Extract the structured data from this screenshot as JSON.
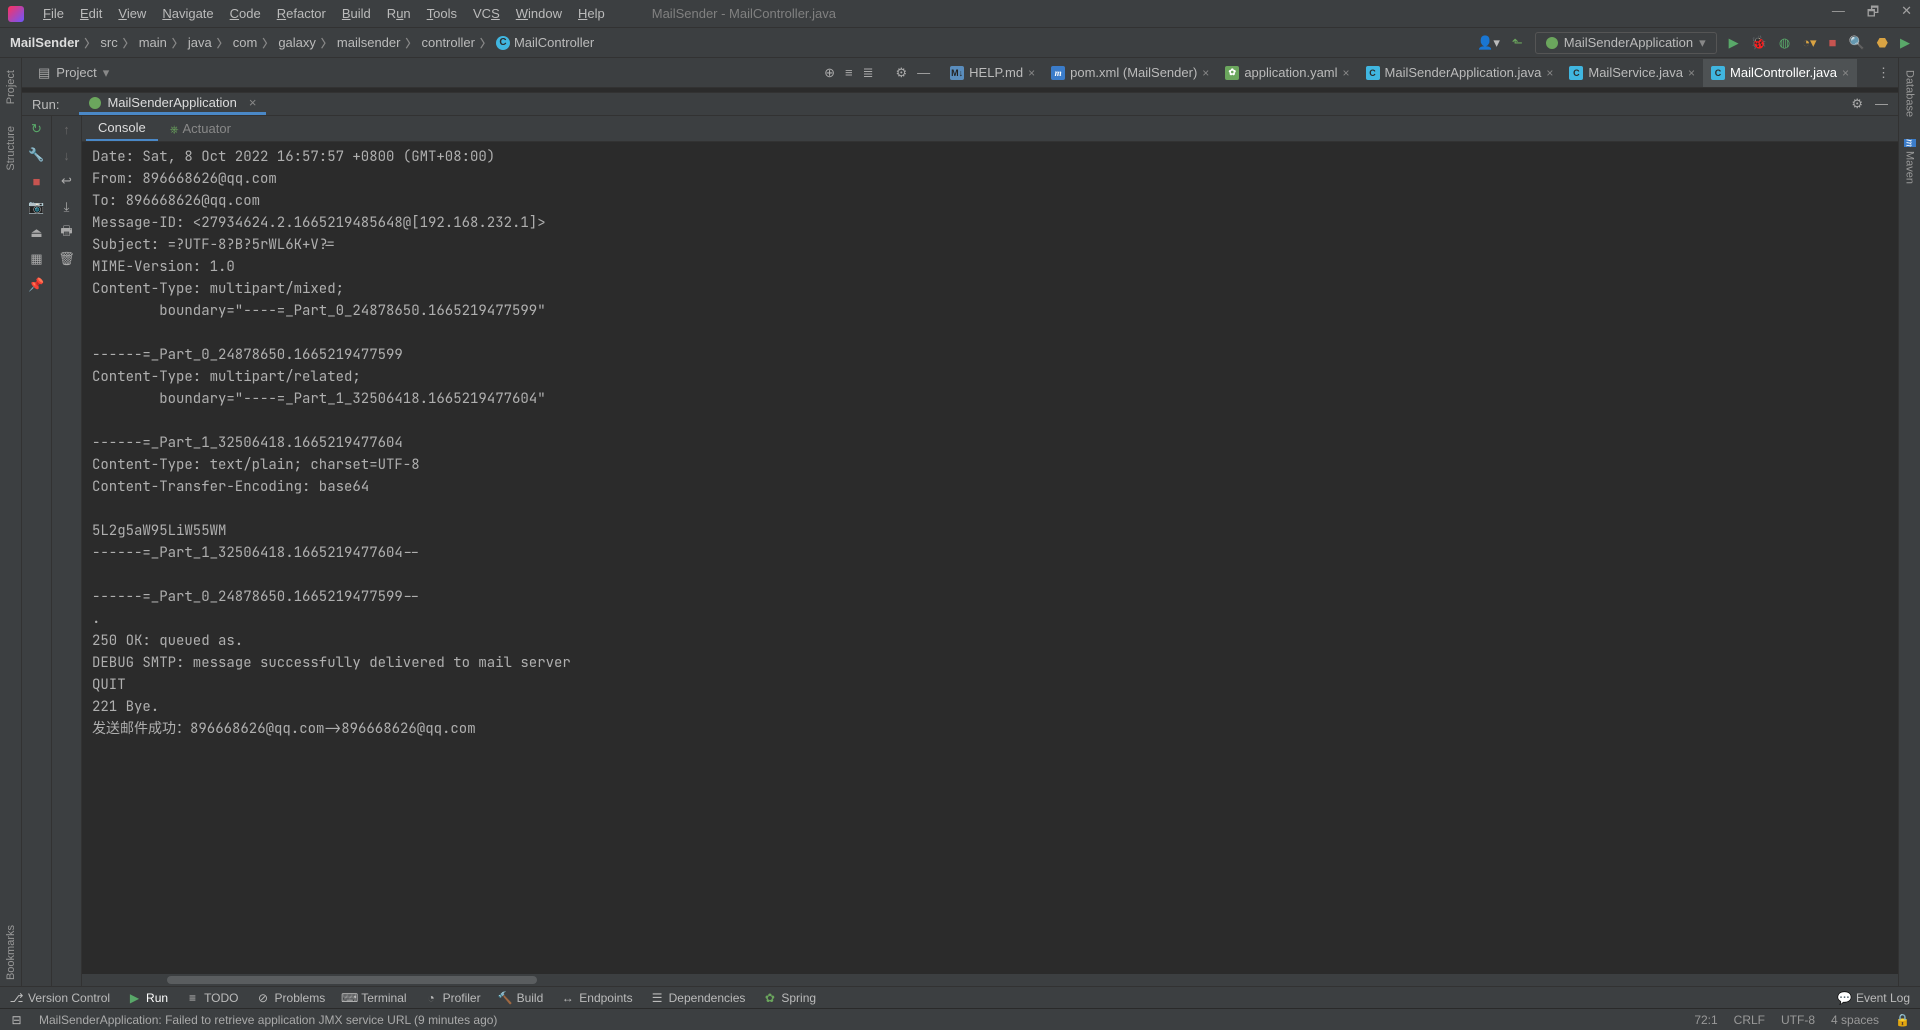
{
  "title": "MailSender - MailController.java",
  "menu": [
    "File",
    "Edit",
    "View",
    "Navigate",
    "Code",
    "Refactor",
    "Build",
    "Run",
    "Tools",
    "VCS",
    "Window",
    "Help"
  ],
  "menu_underlines": [
    "F",
    "E",
    "V",
    "N",
    "C",
    "R",
    "B",
    "R",
    "T",
    "V",
    "W",
    "H"
  ],
  "breadcrumbs": [
    "MailSender",
    "src",
    "main",
    "java",
    "com",
    "galaxy",
    "mailsender",
    "controller",
    "MailController"
  ],
  "run_config_label": "MailSenderApplication",
  "project_panel_label": "Project",
  "editor_tabs": [
    {
      "label": "HELP.md",
      "kind": "md"
    },
    {
      "label": "pom.xml (MailSender)",
      "kind": "m"
    },
    {
      "label": "application.yaml",
      "kind": "sb"
    },
    {
      "label": "MailSenderApplication.java",
      "kind": "java"
    },
    {
      "label": "MailService.java",
      "kind": "java"
    },
    {
      "label": "MailController.java",
      "kind": "java",
      "active": true
    }
  ],
  "run_label": "Run:",
  "run_tab": "MailSenderApplication",
  "console_tabs": {
    "console": "Console",
    "actuator": "Actuator"
  },
  "console_output": "Date: Sat, 8 Oct 2022 16:57:57 +0800 (GMT+08:00)\nFrom: 896668626@qq.com\nTo: 896668626@qq.com\nMessage-ID: <27934624.2.1665219485648@[192.168.232.1]>\nSubject: =?UTF-8?B?5rWL6K+V?=\nMIME-Version: 1.0\nContent-Type: multipart/mixed; \n\tboundary=\"----=_Part_0_24878650.1665219477599\"\n\n------=_Part_0_24878650.1665219477599\nContent-Type: multipart/related; \n\tboundary=\"----=_Part_1_32506418.1665219477604\"\n\n------=_Part_1_32506418.1665219477604\nContent-Type: text/plain; charset=UTF-8\nContent-Transfer-Encoding: base64\n\n5L2g5aW95LiW55WM\n------=_Part_1_32506418.1665219477604--\n\n------=_Part_0_24878650.1665219477599--\n.\n250 OK: queued as.\nDEBUG SMTP: message successfully delivered to mail server\nQUIT\n221 Bye.\n发送邮件成功：896668626@qq.com->896668626@qq.com\n",
  "left_sidebar": {
    "project": "Project",
    "structure": "Structure",
    "bookmarks": "Bookmarks"
  },
  "right_sidebar": {
    "database": "Database",
    "maven": "Maven"
  },
  "bottom_bar": {
    "version_control": "Version Control",
    "run": "Run",
    "todo": "TODO",
    "problems": "Problems",
    "terminal": "Terminal",
    "profiler": "Profiler",
    "build": "Build",
    "endpoints": "Endpoints",
    "dependencies": "Dependencies",
    "spring": "Spring",
    "event_log": "Event Log"
  },
  "status": {
    "msg": "MailSenderApplication: Failed to retrieve application JMX service URL (9 minutes ago)",
    "position": "72:1",
    "line_sep": "CRLF",
    "encoding": "UTF-8",
    "indent": "4 spaces"
  }
}
